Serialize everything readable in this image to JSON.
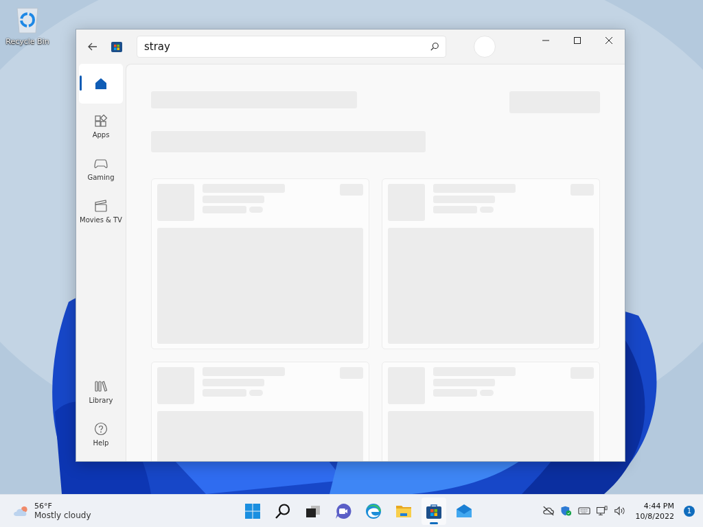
{
  "desktop_icons": [
    {
      "label": "Recycle Bin"
    }
  ],
  "window": {
    "search": {
      "value": "stray"
    }
  },
  "sidebar": {
    "top_items": [
      {
        "kind": "home",
        "selected": true
      },
      {
        "kind": "apps",
        "label": "Apps",
        "selected": false
      },
      {
        "kind": "gaming",
        "label": "Gaming",
        "selected": false
      },
      {
        "kind": "movies",
        "label": "Movies & TV",
        "selected": false
      }
    ],
    "bottom_items": [
      {
        "kind": "library",
        "label": "Library",
        "selected": false
      },
      {
        "kind": "help",
        "label": "Help",
        "selected": false
      }
    ]
  },
  "taskbar": {
    "weather": {
      "temperature": "56°F",
      "condition": "Mostly cloudy"
    },
    "apps": [
      {
        "kind": "start",
        "selected": false
      },
      {
        "kind": "search",
        "selected": false
      },
      {
        "kind": "taskview",
        "selected": false
      },
      {
        "kind": "chat",
        "selected": false
      },
      {
        "kind": "edge",
        "selected": false
      },
      {
        "kind": "explorer",
        "selected": false
      },
      {
        "kind": "store",
        "selected": true
      },
      {
        "kind": "mail",
        "selected": false
      }
    ],
    "tray": [
      {
        "kind": "cloud-off"
      },
      {
        "kind": "shield"
      },
      {
        "kind": "keyboard"
      },
      {
        "kind": "network"
      },
      {
        "kind": "volume"
      }
    ],
    "clock": {
      "time": "4:44 PM",
      "date": "10/8/2022"
    },
    "notifications": "1"
  }
}
